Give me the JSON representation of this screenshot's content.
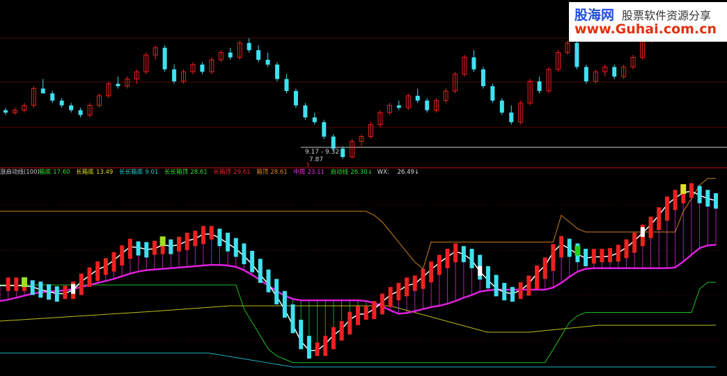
{
  "watermark": {
    "brand": "股海网",
    "slogan": "股票软件资源分享",
    "url": "www.Guhai.com.cn"
  },
  "upper": {
    "low_label": "7.87",
    "range_label": "9.17 - 9.32",
    "signal_label": "5"
  },
  "indicator": {
    "name": "涨启动线(100)",
    "items": [
      {
        "label": "箱底",
        "value": "17.60",
        "color": "#33dd33"
      },
      {
        "label": "长箱底",
        "value": "13.49",
        "color": "#dddd22"
      },
      {
        "label": "长长箱底",
        "value": "9.01",
        "color": "#22cccc"
      },
      {
        "label": "长长箱顶",
        "value": "28.61",
        "color": "#33dd33"
      },
      {
        "label": "长箱顶",
        "value": "29.61",
        "color": "#ee2222"
      },
      {
        "label": "箱顶",
        "value": "28.61",
        "color": "#dd8822"
      },
      {
        "label": "中周",
        "value": "23.11",
        "color": "#ee33ee"
      },
      {
        "label": "启动线",
        "value": "26.30↓",
        "color": "#33dd33"
      },
      {
        "label": "WX:",
        "value": "26.49↓",
        "color": "#dddddd"
      }
    ]
  },
  "colors": {
    "up": "#ee2020",
    "down": "#40e0f0",
    "grid": "#a01010",
    "mid_line": "#e020e0",
    "ma_line": "#ffffff",
    "fast_line": "#20d020",
    "box_top": "#d08020",
    "box_bottom": "#20c020",
    "long_box_bottom": "#c0c020",
    "long_long_box_bottom": "#20b0c0"
  },
  "chart_data": [
    {
      "type": "candlestick",
      "title": "",
      "ylim": [
        7.6,
        14.2
      ],
      "ohlc": [
        [
          9.9,
          10.0,
          9.7,
          9.8
        ],
        [
          9.8,
          10.0,
          9.7,
          9.9
        ],
        [
          9.9,
          10.2,
          9.8,
          10.1
        ],
        [
          10.1,
          10.9,
          10.0,
          10.8
        ],
        [
          10.8,
          11.2,
          10.6,
          10.6
        ],
        [
          10.6,
          10.7,
          10.2,
          10.3
        ],
        [
          10.3,
          10.4,
          10.0,
          10.1
        ],
        [
          10.1,
          10.2,
          9.8,
          9.9
        ],
        [
          9.9,
          10.0,
          9.6,
          9.7
        ],
        [
          9.7,
          10.2,
          9.6,
          10.1
        ],
        [
          10.1,
          10.6,
          10.0,
          10.5
        ],
        [
          10.5,
          11.1,
          10.4,
          11.0
        ],
        [
          11.0,
          11.3,
          10.8,
          10.9
        ],
        [
          10.9,
          11.3,
          10.8,
          11.2
        ],
        [
          11.2,
          11.6,
          11.0,
          11.5
        ],
        [
          11.5,
          12.3,
          11.4,
          12.2
        ],
        [
          12.2,
          12.6,
          12.0,
          12.5
        ],
        [
          12.5,
          12.6,
          11.5,
          11.6
        ],
        [
          11.6,
          11.8,
          11.0,
          11.1
        ],
        [
          11.1,
          11.6,
          11.0,
          11.5
        ],
        [
          11.5,
          11.9,
          11.4,
          11.8
        ],
        [
          11.8,
          11.9,
          11.4,
          11.5
        ],
        [
          11.5,
          12.1,
          11.4,
          12.0
        ],
        [
          12.0,
          12.4,
          11.9,
          12.3
        ],
        [
          12.3,
          12.5,
          12.0,
          12.1
        ],
        [
          12.1,
          12.8,
          12.0,
          12.7
        ],
        [
          12.7,
          12.9,
          12.3,
          12.4
        ],
        [
          12.4,
          12.6,
          11.9,
          12.0
        ],
        [
          12.0,
          12.3,
          11.7,
          11.8
        ],
        [
          11.8,
          11.9,
          11.1,
          11.2
        ],
        [
          11.2,
          11.4,
          10.6,
          10.7
        ],
        [
          10.7,
          10.8,
          10.0,
          10.1
        ],
        [
          10.1,
          10.2,
          9.5,
          9.6
        ],
        [
          9.6,
          9.8,
          9.3,
          9.4
        ],
        [
          9.4,
          9.5,
          8.7,
          8.8
        ],
        [
          8.8,
          8.9,
          8.2,
          8.3
        ],
        [
          8.3,
          8.4,
          7.87,
          7.95
        ],
        [
          7.95,
          8.7,
          7.9,
          8.6
        ],
        [
          8.6,
          8.9,
          8.4,
          8.8
        ],
        [
          8.8,
          9.4,
          8.7,
          9.3
        ],
        [
          9.3,
          9.9,
          9.2,
          9.8
        ],
        [
          9.8,
          10.2,
          9.7,
          10.1
        ],
        [
          10.1,
          10.3,
          9.9,
          10.0
        ],
        [
          10.0,
          10.6,
          9.9,
          10.5
        ],
        [
          10.5,
          10.8,
          10.2,
          10.3
        ],
        [
          10.3,
          10.4,
          9.8,
          9.9
        ],
        [
          9.9,
          10.4,
          9.8,
          10.3
        ],
        [
          10.3,
          10.8,
          10.2,
          10.7
        ],
        [
          10.7,
          11.5,
          10.6,
          11.4
        ],
        [
          11.4,
          12.2,
          11.3,
          12.1
        ],
        [
          12.1,
          12.4,
          11.5,
          11.6
        ],
        [
          11.6,
          11.7,
          10.8,
          10.9
        ],
        [
          10.9,
          11.0,
          10.2,
          10.3
        ],
        [
          10.3,
          10.4,
          9.7,
          9.8
        ],
        [
          9.8,
          10.1,
          9.3,
          9.4
        ],
        [
          9.4,
          10.3,
          9.3,
          10.2
        ],
        [
          10.2,
          11.2,
          10.1,
          11.1
        ],
        [
          11.1,
          11.3,
          10.6,
          10.7
        ],
        [
          10.7,
          11.7,
          10.6,
          11.6
        ],
        [
          11.6,
          12.4,
          11.5,
          12.3
        ],
        [
          12.3,
          12.8,
          12.2,
          12.7
        ],
        [
          12.7,
          12.8,
          11.6,
          11.7
        ],
        [
          11.7,
          11.8,
          11.0,
          11.1
        ],
        [
          11.1,
          11.6,
          11.0,
          11.5
        ],
        [
          11.5,
          11.8,
          11.3,
          11.7
        ],
        [
          11.7,
          11.8,
          11.2,
          11.3
        ],
        [
          11.3,
          11.8,
          11.2,
          11.7
        ],
        [
          11.7,
          12.2,
          11.6,
          12.1
        ],
        [
          12.1,
          12.9,
          12.0,
          12.8
        ],
        [
          12.8,
          13.4,
          12.7,
          13.3
        ]
      ]
    },
    {
      "type": "line",
      "title": "涨启动线(100)",
      "ylim": [
        4,
        34
      ],
      "series": [
        {
          "name": "中周",
          "values": [
            15.2,
            15.4,
            15.7,
            16.0,
            16.3,
            16.5,
            16.6,
            16.7,
            16.8,
            17.0,
            17.3,
            17.6,
            17.9,
            18.2,
            18.5,
            18.9,
            19.3,
            19.6,
            19.8,
            19.9,
            20.0,
            20.1,
            20.2,
            20.3,
            20.4,
            20.5,
            20.6,
            20.6,
            20.5,
            20.3,
            19.8,
            19.1,
            18.3,
            17.5,
            16.7,
            16.0,
            15.5,
            15.3,
            15.3,
            15.3,
            15.3,
            15.3,
            15.3,
            15.3,
            15.3,
            15.2,
            14.9,
            14.4,
            13.8,
            13.3,
            13.4,
            13.7,
            14.0,
            14.3,
            14.5,
            14.8,
            15.2,
            15.7,
            16.1,
            16.6,
            16.8,
            16.9,
            16.9,
            16.9,
            16.9,
            16.9,
            16.9,
            16.9,
            17.2,
            17.9,
            18.8,
            19.6,
            20.0,
            20.1,
            20.1,
            20.1,
            20.1,
            20.1,
            20.1,
            20.1,
            20.1,
            20.1,
            20.1,
            20.2,
            21.1,
            22.1,
            23.1,
            23.5,
            23.6
          ]
        },
        {
          "name": "WX",
          "values": [
            17.5,
            17.5,
            17.5,
            17.5,
            17.3,
            16.9,
            16.6,
            16.3,
            16.3,
            16.9,
            18.1,
            19.0,
            19.9,
            20.4,
            21.3,
            22.3,
            23.3,
            23.2,
            22.9,
            23.0,
            23.6,
            23.4,
            23.6,
            24.2,
            24.5,
            25.2,
            25.2,
            24.6,
            23.8,
            23.0,
            21.9,
            20.7,
            19.1,
            17.7,
            15.9,
            13.9,
            11.6,
            9.2,
            7.8,
            7.8,
            8.8,
            10.1,
            11.0,
            12.4,
            13.2,
            13.3,
            14.0,
            15.1,
            16.1,
            16.7,
            17.5,
            17.8,
            18.8,
            19.9,
            20.9,
            21.8,
            22.6,
            22.2,
            21.3,
            19.6,
            18.3,
            17.1,
            16.5,
            16.3,
            16.8,
            17.8,
            19.3,
            20.5,
            22.5,
            23.7,
            23.0,
            22.2,
            21.6,
            21.8,
            21.8,
            21.9,
            22.4,
            23.2,
            24.2,
            25.4,
            26.6,
            28.0,
            29.6,
            30.6,
            31.4,
            31.6,
            31.0,
            30.5,
            30.2
          ]
        },
        {
          "name": "箱顶",
          "values": [
            28.6,
            28.6,
            28.6,
            28.6,
            28.6,
            28.6,
            28.6,
            28.6,
            28.6,
            28.6,
            28.6,
            28.6,
            28.6,
            28.6,
            28.6,
            28.6,
            28.6,
            28.6,
            28.6,
            28.6,
            28.6,
            28.6,
            28.6,
            28.6,
            28.6,
            28.6,
            28.6,
            28.6,
            28.6,
            28.6,
            28.6,
            28.6,
            28.6,
            28.6,
            28.6,
            28.6,
            28.6,
            28.6,
            28.6,
            28.6,
            28.6,
            28.6,
            28.6,
            28.6,
            28.6,
            28.6,
            28.0,
            27.0,
            25.5,
            24.0,
            22.5,
            21.0,
            20.0,
            24.0,
            24.0,
            24.0,
            24.0,
            24.0,
            24.0,
            24.0,
            24.0,
            24.0,
            24.0,
            24.0,
            24.0,
            24.0,
            24.0,
            24.0,
            24.0,
            28.0,
            27.0,
            26.0,
            25.5,
            25.5,
            25.5,
            25.5,
            25.5,
            25.5,
            25.5,
            25.5,
            25.5,
            25.5,
            25.5,
            25.5,
            28.6,
            30.5,
            32.5,
            33.5,
            33.5
          ]
        },
        {
          "name": "箱底",
          "values": [
            17.6,
            17.6,
            17.6,
            17.6,
            17.6,
            17.6,
            17.6,
            17.6,
            17.6,
            17.6,
            17.6,
            17.6,
            17.6,
            17.6,
            17.6,
            17.6,
            17.6,
            17.6,
            17.6,
            17.6,
            17.6,
            17.6,
            17.6,
            17.6,
            17.6,
            17.6,
            17.6,
            17.6,
            17.6,
            17.6,
            14.0,
            12.0,
            10.0,
            8.0,
            7.0,
            6.5,
            6.0,
            6.0,
            6.0,
            6.0,
            6.0,
            6.0,
            6.0,
            6.0,
            6.0,
            6.0,
            6.0,
            6.0,
            6.0,
            6.0,
            6.0,
            6.0,
            6.0,
            6.0,
            6.0,
            6.0,
            6.0,
            6.0,
            6.0,
            6.0,
            6.0,
            6.0,
            6.0,
            6.0,
            6.0,
            6.0,
            6.0,
            6.0,
            8.0,
            10.0,
            12.0,
            13.0,
            13.5,
            13.5,
            13.5,
            13.5,
            13.5,
            13.5,
            13.5,
            13.5,
            13.5,
            13.5,
            13.5,
            13.5,
            13.5,
            13.5,
            17.0,
            18.0,
            18.0
          ]
        }
      ]
    }
  ]
}
